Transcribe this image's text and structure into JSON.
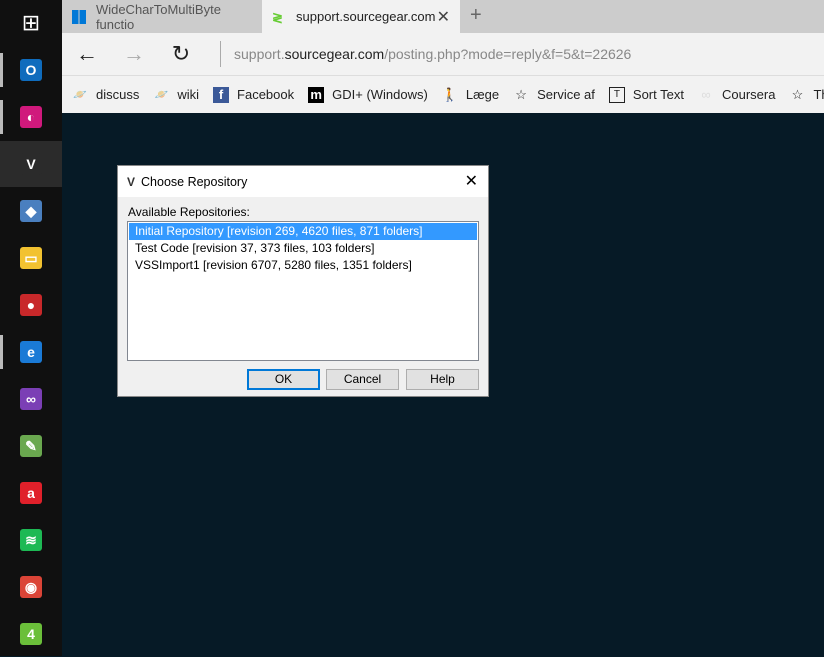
{
  "taskbar": {
    "items": [
      {
        "name": "start",
        "color": "#101010",
        "glyph": "⊞"
      },
      {
        "name": "outlook",
        "color": "#0f6cbd",
        "glyph": "O"
      },
      {
        "name": "planet-app",
        "color": "#d0197c",
        "glyph": "◐"
      },
      {
        "name": "sourcegear-vault",
        "color": "#2b2b2b",
        "glyph": "V"
      },
      {
        "name": "remote-app",
        "color": "#4a7fbf",
        "glyph": "◆"
      },
      {
        "name": "file-explorer",
        "color": "#f2c230",
        "glyph": "▭"
      },
      {
        "name": "red-circle-app",
        "color": "#c8282a",
        "glyph": "●"
      },
      {
        "name": "edge",
        "color": "#1a7ad6",
        "glyph": "e"
      },
      {
        "name": "visual-studio",
        "color": "#7b3fb5",
        "glyph": "∞"
      },
      {
        "name": "notepad",
        "color": "#6aa84f",
        "glyph": "✎"
      },
      {
        "name": "red-a-app",
        "color": "#e0202a",
        "glyph": "a"
      },
      {
        "name": "spotify",
        "color": "#1db954",
        "glyph": "≋"
      },
      {
        "name": "chrome",
        "color": "#db4437",
        "glyph": "◉"
      },
      {
        "name": "green-4-app",
        "color": "#6bbf3a",
        "glyph": "4"
      }
    ]
  },
  "tabs": [
    {
      "title": "WideCharToMultiByte functio",
      "icon": "windows-icon"
    },
    {
      "title": "support.sourcegear.com",
      "icon": "sourcegear-icon",
      "close": "✕"
    }
  ],
  "new_tab": "+",
  "address": {
    "prefix": "support.",
    "domain": "sourcegear.com",
    "path": "/posting.php?mode=reply&f=5&t=22626"
  },
  "bookmarks": [
    {
      "label": "discuss",
      "icon": "planet-icon",
      "glyph": "🪐"
    },
    {
      "label": "wiki",
      "icon": "planet-icon",
      "glyph": "🪐"
    },
    {
      "label": "Facebook",
      "icon": "facebook-icon",
      "glyph": "f"
    },
    {
      "label": "GDI+ (Windows)",
      "icon": "m-icon",
      "glyph": "m"
    },
    {
      "label": "Læge",
      "icon": "person-icon",
      "glyph": "🚶"
    },
    {
      "label": "Service af",
      "icon": "star-icon",
      "glyph": "☆"
    },
    {
      "label": "Sort Text",
      "icon": "text-icon",
      "glyph": "T"
    },
    {
      "label": "Coursera",
      "icon": "infinity-icon",
      "glyph": "∞"
    },
    {
      "label": "The M",
      "icon": "star-icon",
      "glyph": "☆"
    }
  ],
  "dialog": {
    "title": "Choose Repository",
    "close": "✕",
    "label": "Available Repositories:",
    "repositories": [
      "Initial Repository [revision 269, 4620 files, 871 folders]",
      "Test Code [revision 37, 373 files, 103 folders]",
      "VSSImport1 [revision 6707, 5280 files, 1351 folders]"
    ],
    "selected_index": 0,
    "ok": "OK",
    "cancel": "Cancel",
    "help": "Help"
  }
}
